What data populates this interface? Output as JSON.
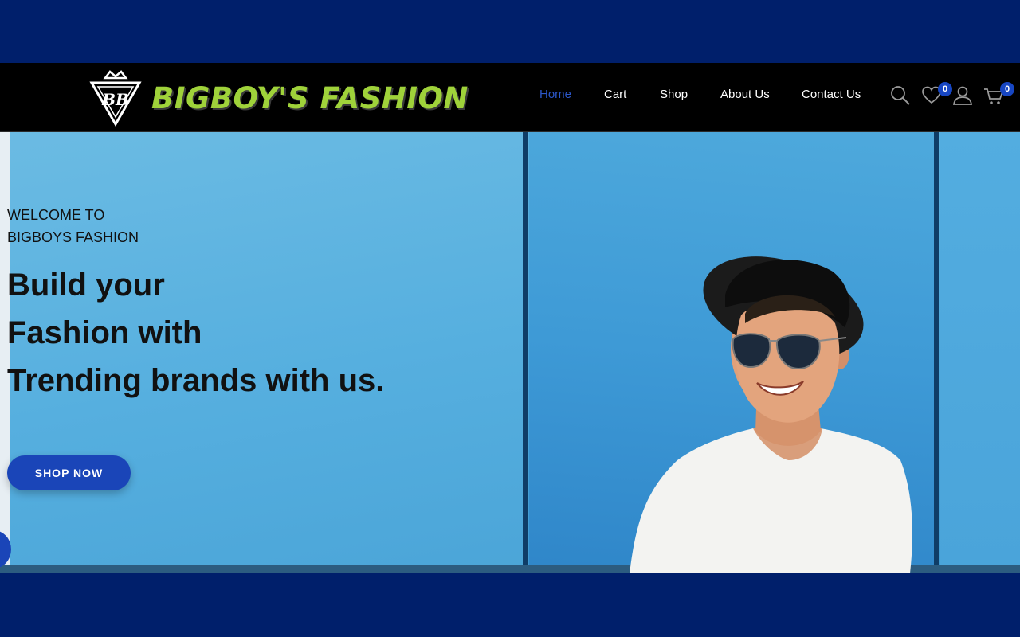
{
  "brand": {
    "name": "BIGBOY'S FASHION",
    "monogram": "BB"
  },
  "nav": {
    "links": [
      "Home",
      "Cart",
      "Shop",
      "About Us",
      "Contact Us"
    ],
    "active": "Home"
  },
  "header_icons": {
    "search": "search-icon",
    "wishlist": "heart-icon",
    "wishlist_count": "0",
    "account": "user-icon",
    "cart": "cart-icon",
    "cart_count": "0"
  },
  "hero": {
    "welcome_line1": "WELCOME TO",
    "welcome_line2": "BIGBOYS FASHION",
    "headline_line1": "Build your",
    "headline_line2": "Fashion with",
    "headline_line3": "Trending brands with us.",
    "cta_label": "SHOP NOW"
  },
  "colors": {
    "header_bg": "#000000",
    "page_band": "#001f6b",
    "accent": "#1a45b8",
    "active_link": "#2c57c9",
    "logo_green": "#9fd23a",
    "hero_blue": "#4aa6da"
  }
}
